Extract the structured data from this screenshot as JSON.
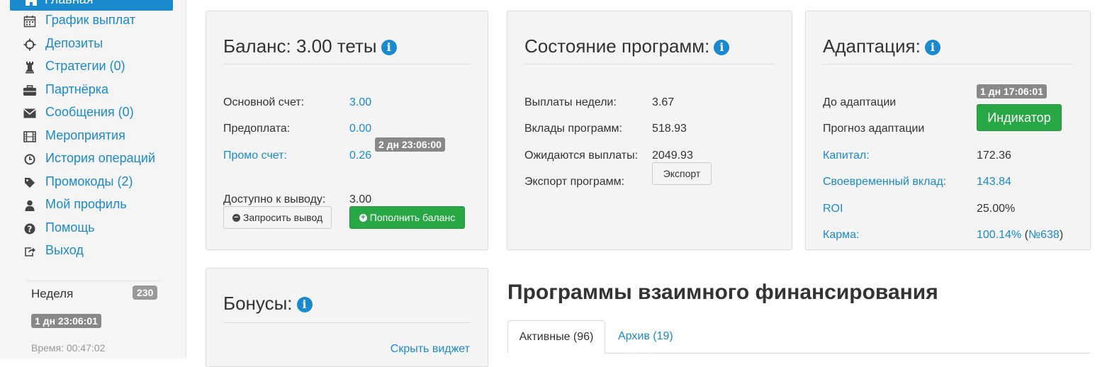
{
  "sidebar": {
    "active": {
      "label": "Главная",
      "icon": "home-icon"
    },
    "items": [
      {
        "label": "График выплат",
        "icon": "calendar-icon"
      },
      {
        "label": "Депозиты",
        "icon": "crosshair-icon"
      },
      {
        "label": "Стратегии (0)",
        "icon": "chess-rook-icon"
      },
      {
        "label": "Партнёрка",
        "icon": "briefcase-icon"
      },
      {
        "label": "Сообщения (0)",
        "icon": "envelope-icon"
      },
      {
        "label": "Мероприятия",
        "icon": "film-icon"
      },
      {
        "label": "История операций",
        "icon": "clock-icon"
      },
      {
        "label": "Промокоды (2)",
        "icon": "tag-icon"
      },
      {
        "label": "Мой профиль",
        "icon": "user-icon"
      },
      {
        "label": "Помощь",
        "icon": "question-icon"
      },
      {
        "label": "Выход",
        "icon": "exit-icon"
      }
    ],
    "week_label": "Неделя",
    "week_count": "230",
    "week_timer": "1 дн 23:06:01",
    "time_text": "Время: 00:47:02"
  },
  "balance": {
    "title": "Баланс: 3.00 теты",
    "main_label": "Основной счет:",
    "main_value": "3.00",
    "prepay_label": "Предоплата:",
    "prepay_value": "0.00",
    "promo_label": "Промо счет:",
    "promo_value": "0.26",
    "promo_timer": "2 дн 23:06:00",
    "available_label": "Доступно к выводу:",
    "available_value": "3.00",
    "withdraw_button": "Запросить вывод",
    "topup_button": "Пополнить баланс"
  },
  "programs_state": {
    "title": "Состояние программ:",
    "week_payouts_label": "Выплаты недели:",
    "week_payouts_value": "3.67",
    "deposits_label": "Вклады программ:",
    "deposits_value": "518.93",
    "expected_label": "Ожидаются выплаты:",
    "expected_value": "2049.93",
    "export_label": "Экспорт программ:",
    "export_button": "Экспорт"
  },
  "adaptation": {
    "title": "Адаптация:",
    "until_label": "До адаптации",
    "until_timer": "1 дн 17:06:01",
    "forecast_label": "Прогноз адаптации",
    "indicator_button": "Индикатор",
    "capital_label": "Капитал:",
    "capital_value": "172.36",
    "timely_label": "Своевременный вклад:",
    "timely_value": "143.84",
    "roi_label": "ROI",
    "roi_value": "25.00%",
    "karma_label": "Карма:",
    "karma_value": "100.14%",
    "karma_paren_open": "(",
    "karma_rank": "№638",
    "karma_paren_close": ")"
  },
  "bonuses": {
    "title": "Бонусы:",
    "hide_link": "Скрыть виджет"
  },
  "programs_section": {
    "heading": "Программы взаимного финансирования",
    "tab_active": "Активные (96)",
    "tab_archive": "Архив (19)"
  },
  "colors": {
    "accent": "#1a8ad0",
    "success": "#28a745",
    "badge": "#888888"
  }
}
